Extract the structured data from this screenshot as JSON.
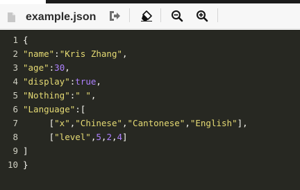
{
  "toolbar": {
    "filename": "example.json",
    "icons": [
      "file-icon",
      "export-icon",
      "eraser-icon",
      "zoom-out-icon",
      "zoom-in-icon"
    ]
  },
  "editor": {
    "theme": {
      "background": "#272822",
      "string": "#e6db74",
      "number": "#ae81ff",
      "text": "#f8f8f2"
    },
    "lines": [
      {
        "num": "1",
        "tokens": [
          [
            "p",
            "{"
          ]
        ]
      },
      {
        "num": "2",
        "tokens": [
          [
            "s",
            "\"name\""
          ],
          [
            "p",
            ":"
          ],
          [
            "s",
            "\"Kris Zhang\""
          ],
          [
            "p",
            ","
          ]
        ]
      },
      {
        "num": "3",
        "tokens": [
          [
            "s",
            "\"age\""
          ],
          [
            "p",
            ":"
          ],
          [
            "n",
            "30"
          ],
          [
            "p",
            ","
          ]
        ]
      },
      {
        "num": "4",
        "tokens": [
          [
            "s",
            "\"display\""
          ],
          [
            "p",
            ":"
          ],
          [
            "n",
            "true"
          ],
          [
            "p",
            ","
          ]
        ]
      },
      {
        "num": "5",
        "tokens": [
          [
            "s",
            "\"Nothing\""
          ],
          [
            "p",
            ":"
          ],
          [
            "s",
            "\" \""
          ],
          [
            "p",
            ","
          ]
        ]
      },
      {
        "num": "6",
        "tokens": [
          [
            "s",
            "\"Language\""
          ],
          [
            "p",
            ":["
          ]
        ]
      },
      {
        "num": "7",
        "tokens": [
          [
            "p",
            "     ["
          ],
          [
            "s",
            "\"x\""
          ],
          [
            "p",
            ","
          ],
          [
            "s",
            "\"Chinese\""
          ],
          [
            "p",
            ","
          ],
          [
            "s",
            "\"Cantonese\""
          ],
          [
            "p",
            ","
          ],
          [
            "s",
            "\"English\""
          ],
          [
            "p",
            "],"
          ]
        ]
      },
      {
        "num": "8",
        "tokens": [
          [
            "p",
            "     ["
          ],
          [
            "s",
            "\"level\""
          ],
          [
            "p",
            ","
          ],
          [
            "n",
            "5"
          ],
          [
            "p",
            ","
          ],
          [
            "n",
            "2"
          ],
          [
            "p",
            ","
          ],
          [
            "n",
            "4"
          ],
          [
            "p",
            "]"
          ]
        ]
      },
      {
        "num": "9",
        "tokens": [
          [
            "p",
            "]"
          ]
        ]
      },
      {
        "num": "10",
        "tokens": [
          [
            "p",
            "}"
          ]
        ]
      }
    ]
  }
}
